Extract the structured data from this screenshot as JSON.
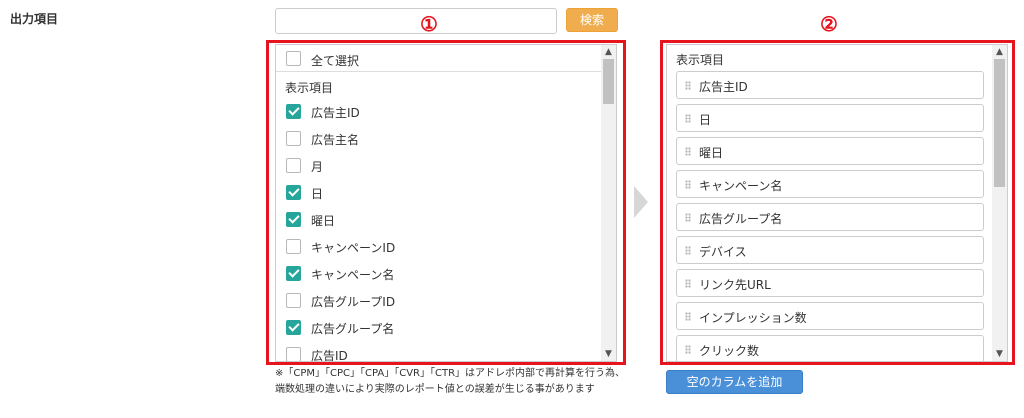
{
  "section_label": "出力項目",
  "search": {
    "placeholder": "",
    "button_label": "検索"
  },
  "markers": {
    "first": "①",
    "second": "②"
  },
  "left_panel": {
    "select_all_label": "全て選択",
    "group_title": "表示項目",
    "items": [
      {
        "label": "広告主ID",
        "checked": true
      },
      {
        "label": "広告主名",
        "checked": false
      },
      {
        "label": "月",
        "checked": false
      },
      {
        "label": "日",
        "checked": true
      },
      {
        "label": "曜日",
        "checked": true
      },
      {
        "label": "キャンペーンID",
        "checked": false
      },
      {
        "label": "キャンペーン名",
        "checked": true
      },
      {
        "label": "広告グループID",
        "checked": false
      },
      {
        "label": "広告グループ名",
        "checked": true
      },
      {
        "label": "広告ID",
        "checked": false
      }
    ]
  },
  "right_panel": {
    "group_title": "表示項目",
    "items": [
      {
        "label": "広告主ID"
      },
      {
        "label": "日"
      },
      {
        "label": "曜日"
      },
      {
        "label": "キャンペーン名"
      },
      {
        "label": "広告グループ名"
      },
      {
        "label": "デバイス"
      },
      {
        "label": "リンク先URL"
      },
      {
        "label": "インプレッション数"
      },
      {
        "label": "クリック数"
      }
    ]
  },
  "note": "※「CPM」「CPC」「CPA」「CVR」「CTR」はアドレポ内部で再計算を行う為、端数処理の違いにより実際のレポート値との誤差が生じる事があります",
  "add_column_button": "空のカラムを追加",
  "colors": {
    "accent_red": "#e6141e",
    "checkbox_teal": "#26a69a",
    "search_orange": "#f0ad4e",
    "button_blue": "#4a90d9"
  }
}
